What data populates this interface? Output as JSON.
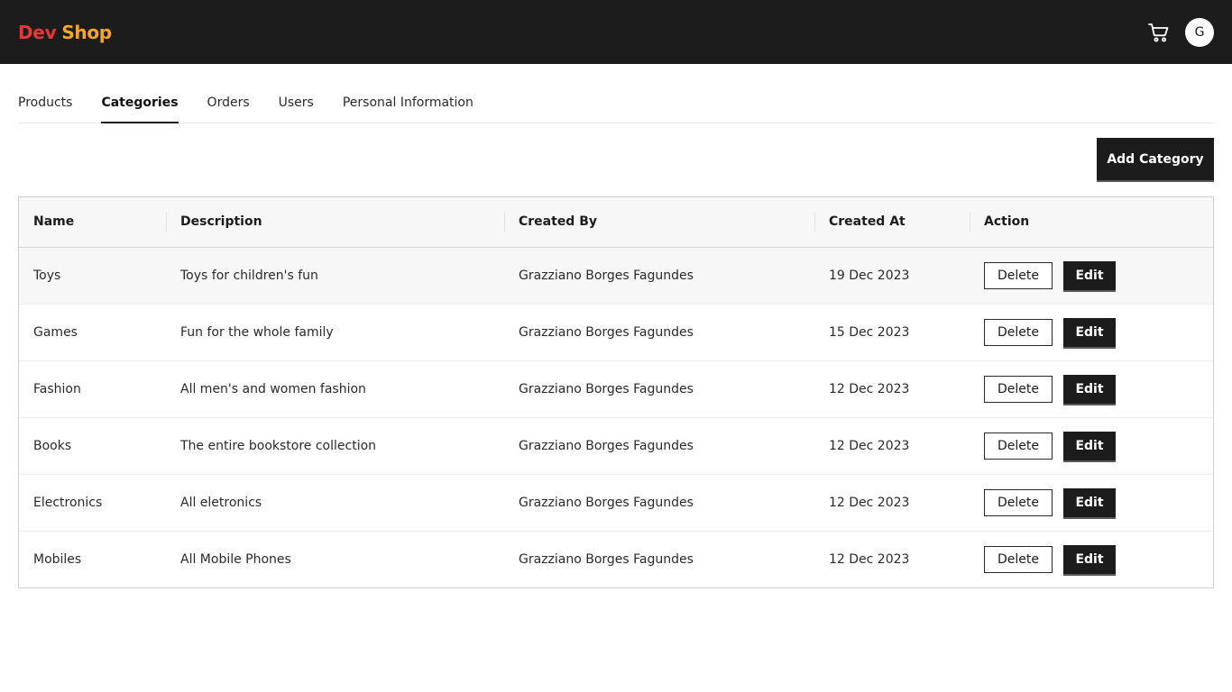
{
  "header": {
    "logo_part1": "Dev",
    "logo_part2": "Shop",
    "logo_colors": {
      "dev": "#e53935",
      "shop": "#f5a623"
    },
    "cart_icon": "cart-icon",
    "avatar_initial": "G"
  },
  "tabs": [
    {
      "label": "Products",
      "active": false
    },
    {
      "label": "Categories",
      "active": true
    },
    {
      "label": "Orders",
      "active": false
    },
    {
      "label": "Users",
      "active": false
    },
    {
      "label": "Personal Information",
      "active": false
    }
  ],
  "toolbar": {
    "add_label": "Add Category"
  },
  "table": {
    "columns": [
      "Name",
      "Description",
      "Created By",
      "Created At",
      "Action"
    ],
    "rows": [
      {
        "name": "Toys",
        "description": "Toys for children's fun",
        "created_by": "Grazziano Borges Fagundes",
        "created_at": "19 Dec 2023"
      },
      {
        "name": "Games",
        "description": "Fun for the whole family",
        "created_by": "Grazziano Borges Fagundes",
        "created_at": "15 Dec 2023"
      },
      {
        "name": "Fashion",
        "description": "All men's and women fashion",
        "created_by": "Grazziano Borges Fagundes",
        "created_at": "12 Dec 2023"
      },
      {
        "name": "Books",
        "description": "The entire bookstore collection",
        "created_by": "Grazziano Borges Fagundes",
        "created_at": "12 Dec 2023"
      },
      {
        "name": "Electronics",
        "description": "All eletronics",
        "created_by": "Grazziano Borges Fagundes",
        "created_at": "12 Dec 2023"
      },
      {
        "name": "Mobiles",
        "description": "All Mobile Phones",
        "created_by": "Grazziano Borges Fagundes",
        "created_at": "12 Dec 2023"
      }
    ],
    "delete_label": "Delete",
    "edit_label": "Edit"
  }
}
